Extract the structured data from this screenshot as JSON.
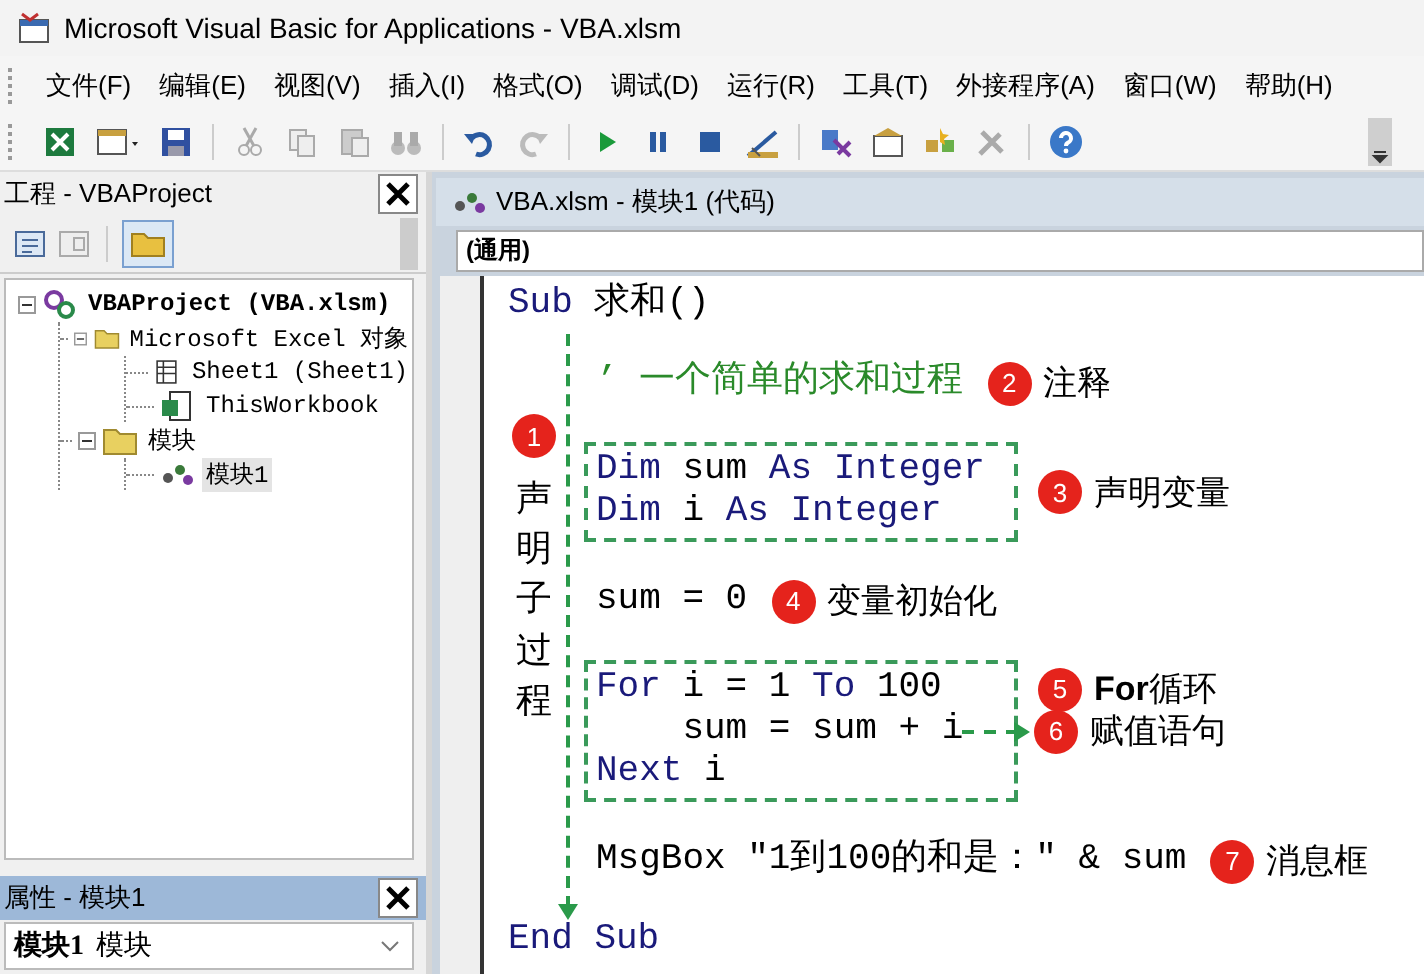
{
  "window": {
    "title": "Microsoft Visual Basic for Applications - VBA.xlsm"
  },
  "menu": [
    "文件(F)",
    "编辑(E)",
    "视图(V)",
    "插入(I)",
    "格式(O)",
    "调试(D)",
    "运行(R)",
    "工具(T)",
    "外接程序(A)",
    "窗口(W)",
    "帮助(H)"
  ],
  "project_pane": {
    "title": "工程 - VBAProject",
    "tree": [
      {
        "label": "VBAProject (VBA.xlsm)",
        "kind": "project",
        "expanded": true,
        "selected": false,
        "children": [
          {
            "label": "Microsoft Excel 对象",
            "kind": "folder",
            "expanded": true,
            "selected": false,
            "children": [
              {
                "label": "Sheet1 (Sheet1)",
                "kind": "sheet",
                "selected": false
              },
              {
                "label": "ThisWorkbook",
                "kind": "workbook",
                "selected": false
              }
            ]
          },
          {
            "label": "模块",
            "kind": "folder",
            "expanded": true,
            "selected": false,
            "children": [
              {
                "label": "模块1",
                "kind": "module",
                "selected": true
              }
            ]
          }
        ]
      }
    ]
  },
  "properties_pane": {
    "title": "属性 - 模块1",
    "object_name": "模块1",
    "object_type": "模块"
  },
  "code_window": {
    "title": "VBA.xlsm - 模块1 (代码)",
    "object_combo": "(通用)",
    "first_line": [
      {
        "text": "Sub",
        "kind": "keyword"
      },
      {
        "text": " 求和()",
        "kind": "plain"
      }
    ],
    "side_note": {
      "number": "1",
      "text": "声明子过程"
    },
    "blocks": [
      {
        "lines": [
          {
            "tokens": [
              {
                "text": "’ 一个简单的求和过程",
                "kind": "comment"
              }
            ],
            "note": {
              "number": "2",
              "text": "注释"
            }
          }
        ]
      },
      {
        "boxed": true,
        "note": {
          "number": "3",
          "text": "声明变量"
        },
        "lines": [
          {
            "tokens": [
              {
                "text": "Dim",
                "kind": "keyword"
              },
              {
                "text": " sum ",
                "kind": "plain"
              },
              {
                "text": "As Integer",
                "kind": "keyword"
              }
            ]
          },
          {
            "tokens": [
              {
                "text": "Dim",
                "kind": "keyword"
              },
              {
                "text": " i ",
                "kind": "plain"
              },
              {
                "text": "As Integer",
                "kind": "keyword"
              }
            ]
          }
        ]
      },
      {
        "lines": [
          {
            "tokens": [
              {
                "text": "sum = 0",
                "kind": "plain"
              }
            ],
            "note": {
              "number": "4",
              "text": "变量初始化"
            }
          }
        ]
      },
      {
        "boxed": true,
        "lines": [
          {
            "tokens": [
              {
                "text": "For",
                "kind": "keyword"
              },
              {
                "text": " i = 1 ",
                "kind": "plain"
              },
              {
                "text": "To",
                "kind": "keyword"
              },
              {
                "text": " 100",
                "kind": "plain"
              }
            ],
            "note": {
              "number": "5",
              "text": "**For**循环"
            }
          },
          {
            "tokens": [
              {
                "text": "    sum = sum + i",
                "kind": "plain"
              }
            ],
            "note": {
              "number": "6",
              "text": "赋值语句",
              "arrow": true
            }
          },
          {
            "tokens": [
              {
                "text": "Next",
                "kind": "keyword"
              },
              {
                "text": " i",
                "kind": "plain"
              }
            ]
          }
        ]
      },
      {
        "lines": [
          {
            "tokens": [
              {
                "text": "MsgBox ″1到100的和是：″ & sum",
                "kind": "plain"
              }
            ],
            "note": {
              "number": "7",
              "text": "消息框"
            }
          }
        ]
      }
    ],
    "last_line": [
      {
        "text": "End Sub",
        "kind": "keyword"
      }
    ]
  }
}
